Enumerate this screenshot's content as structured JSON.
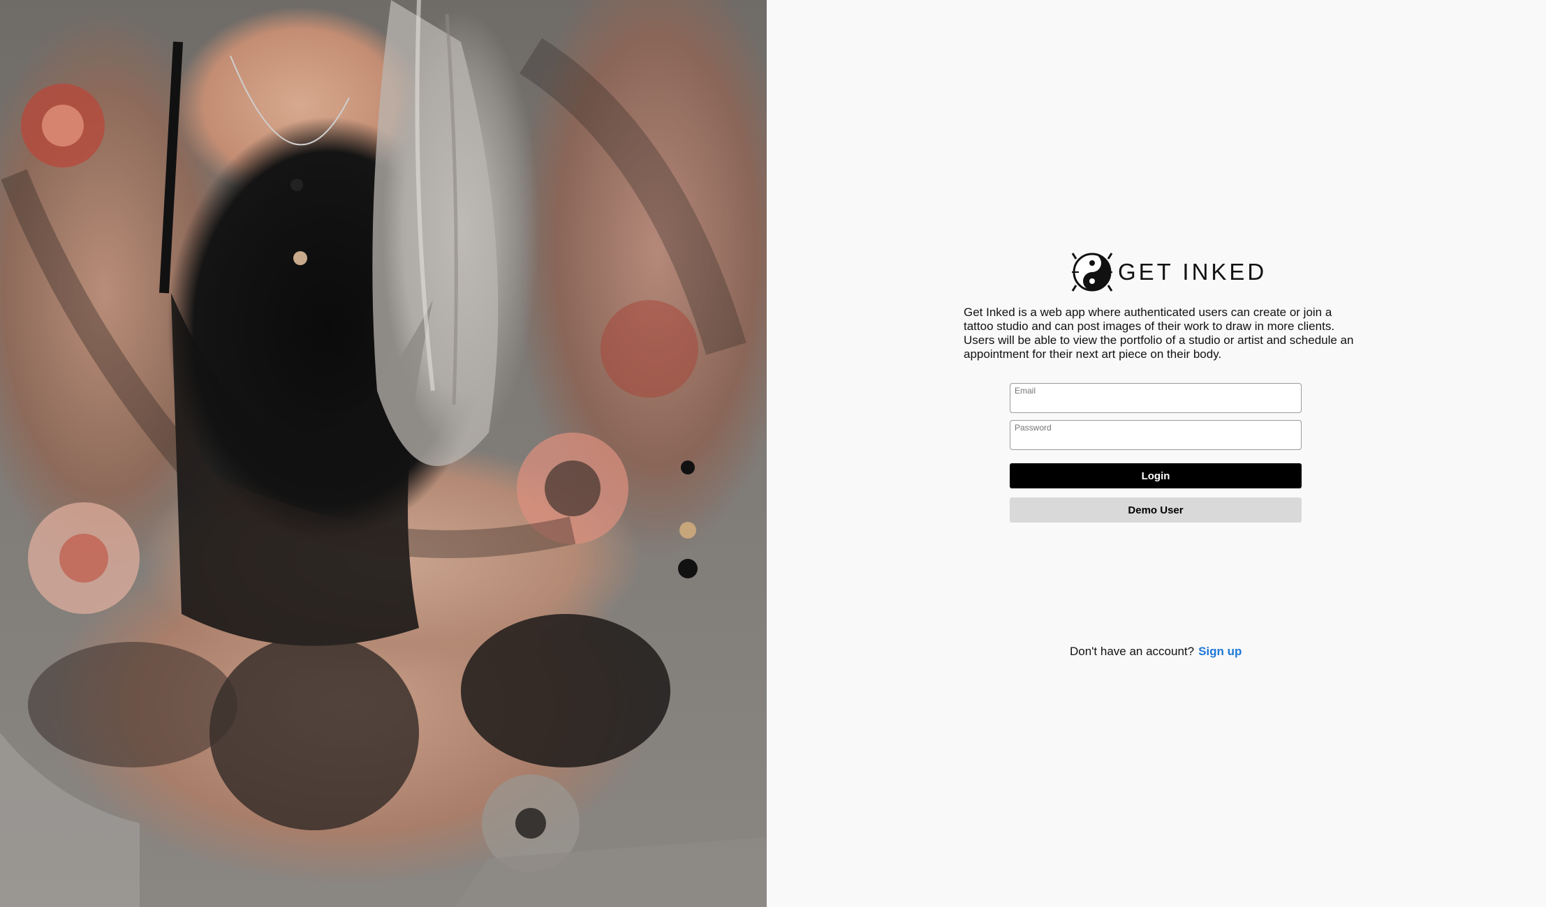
{
  "brand": {
    "title": "GET INKED",
    "logo_icon": "dragon-tiger-yin-yang-icon"
  },
  "hero": {
    "image": "tattooed-woman-photo"
  },
  "description": "Get Inked is a web app where authenticated users can create or join a tattoo studio and can post images of their work to draw in more clients. Users will be able to view the portfolio of a studio or artist and schedule an appointment for their next art piece on their body.",
  "form": {
    "email_label": "Email",
    "email_value": "",
    "password_label": "Password",
    "password_value": "",
    "login_label": "Login",
    "demo_label": "Demo User"
  },
  "signup": {
    "prompt": "Don't have an account?",
    "link_label": "Sign up"
  },
  "colors": {
    "login_bg": "#000000",
    "demo_bg": "#d9d9d9",
    "link": "#1f78d6",
    "panel_bg": "#f9f9f9"
  }
}
